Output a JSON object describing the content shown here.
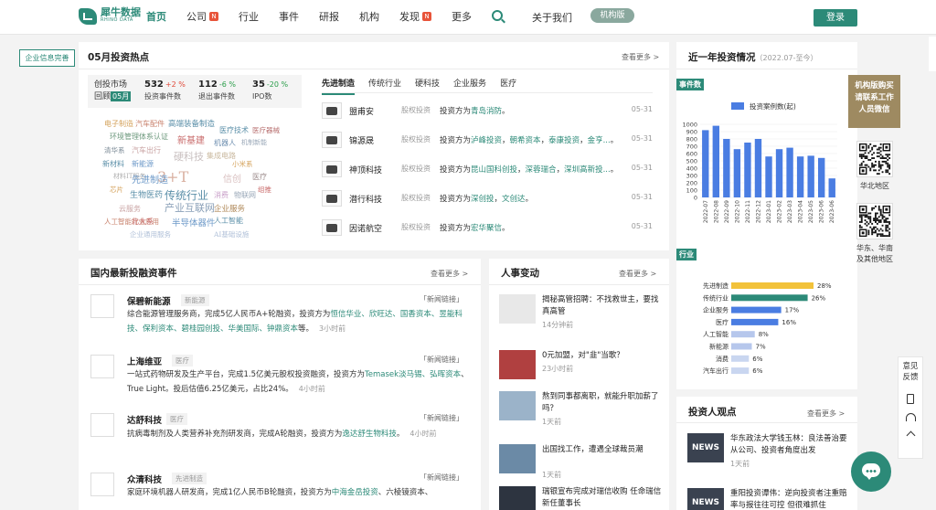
{
  "header": {
    "logo_cn": "犀牛数据",
    "logo_en": "RHINO DATA",
    "nav": [
      {
        "label": "首页",
        "active": true,
        "badge": ""
      },
      {
        "label": "公司",
        "badge": "N"
      },
      {
        "label": "行业",
        "badge": ""
      },
      {
        "label": "事件",
        "badge": ""
      },
      {
        "label": "研报",
        "badge": ""
      },
      {
        "label": "机构",
        "badge": ""
      },
      {
        "label": "发现",
        "badge": "N"
      },
      {
        "label": "更多",
        "badge": ""
      }
    ],
    "about": "关于我们",
    "org_version": "机构版",
    "login": "登录"
  },
  "company_info_button": "企业信息完善",
  "hot": {
    "title": "05月投资热点",
    "more": "查看更多 >",
    "stats_label_1": "创投市场",
    "stats_label_2": "回顾",
    "stats_month": "05月",
    "stats": [
      {
        "num": "532",
        "pct": "+2 %",
        "dir": "up",
        "label": "投资事件数"
      },
      {
        "num": "112",
        "pct": "-6 %",
        "dir": "down",
        "label": "退出事件数"
      },
      {
        "num": "35",
        "pct": "-20 %",
        "dir": "down",
        "label": "IPO数"
      }
    ],
    "cloud": [
      "电子制造",
      "汽车配件",
      "高端装备制造",
      "医疗技术",
      "医疗器械",
      "环境管理体系认证",
      "新基建",
      "机器人",
      "机制新能",
      "清华系",
      "汽车出行",
      "硬科技",
      "集成电路",
      "新材料",
      "新能源",
      "小米系",
      "材料IT服务",
      "3+T",
      "先进制造",
      "信创",
      "医疗",
      "芯片",
      "组推",
      "生物医药",
      "传统行业",
      "消费",
      "物联网",
      "云服务",
      "产业互联网",
      "企业服务",
      "人工智能行业应用",
      "北大系",
      "半导体器件",
      "人工智能",
      "企业通用服务",
      "AI基础设施",
      "集成电路芯片"
    ],
    "tabs": [
      "先进制造",
      "传统行业",
      "硬科技",
      "企业服务",
      "医疗"
    ],
    "deals": [
      {
        "name": "盟甫安",
        "type": "股权投资",
        "prefix": "投资方为",
        "investors": [
          "青岛消防"
        ],
        "date": "05-31"
      },
      {
        "name": "锦源晟",
        "type": "股权投资",
        "prefix": "投资方为",
        "investors": [
          "泸峰投资",
          "朝希资本",
          "泰康投资",
          "金亨..."
        ],
        "date": "05-31"
      },
      {
        "name": "神顶科技",
        "type": "股权投资",
        "prefix": "投资方为",
        "investors": [
          "昆山国科创投",
          "深蓉瑞合",
          "深圳高新投..."
        ],
        "date": "05-31"
      },
      {
        "name": "潜行科技",
        "type": "股权投资",
        "prefix": "投资方为",
        "investors": [
          "深创投",
          "文创达"
        ],
        "date": "05-31"
      },
      {
        "name": "因诺航空",
        "type": "股权投资",
        "prefix": "投资方为",
        "investors": [
          "宏华聚信"
        ],
        "date": "05-31"
      }
    ]
  },
  "news": {
    "title": "国内最新投融资事件",
    "more": "查看更多 >",
    "items": [
      {
        "name": "保碧新能源",
        "tag": "新能源",
        "link": "「新闻链接」",
        "desc_pre": "综合能源管理服务商，完成5亿人民币A+轮融资，投资方为",
        "investors": "恒信华业、欣旺达、国香资本、昱能科技、保利资本、碧桂园创投、华美国际、钟鼎资本",
        "desc_post": "等。",
        "time": "3小时前"
      },
      {
        "name": "上海维亚",
        "tag": "医疗",
        "link": "「新闻链接」",
        "desc_pre": "一站式药物研发及生产平台，完成1.5亿美元股权投资融资，投资方为",
        "investors": "Temasek淡马锡、弘晖资本",
        "desc_post": "、True Light。投后估值6.25亿美元，占比24%。",
        "time": "4小时前"
      },
      {
        "name": "达舒科技",
        "tag": "医疗",
        "link": "「新闻链接」",
        "desc_pre": "抗病毒制剂及人类营养补充剂研发商，完成A轮融资，投资方为",
        "investors": "逸达舒生物科技",
        "desc_post": "。",
        "time": "4小时前"
      },
      {
        "name": "众清科技",
        "tag": "先进制造",
        "link": "「新闻链接」",
        "desc_pre": "家庭环境机器人研发商，完成1亿人民币B轮融资，投资方为",
        "investors": "中海金岳投资",
        "desc_post": "、六棱镜资本、",
        "time": ""
      }
    ]
  },
  "people": {
    "title": "人事变动",
    "more": "查看更多 >",
    "items": [
      {
        "title": "揭秘高管招聘：不找救世主，要找真高管",
        "time": "14分钟前"
      },
      {
        "title": "0元加盟，对\"韭\"当歌？",
        "time": "23小时前"
      },
      {
        "title": "熬到同事都离职，就能升职加薪了吗？",
        "time": "1天前"
      },
      {
        "title": "出国找工作，遭遇全球裁员潮",
        "time": "1天前"
      },
      {
        "title": "瑞银宣布完成对瑞信收购 任命瑞信新任董事长",
        "time": ""
      }
    ]
  },
  "year": {
    "title": "近一年投资情况",
    "subtitle": "（2022.07-至今）",
    "events_badge": "事件数",
    "industry_badge": "行业"
  },
  "chart_data": [
    {
      "type": "bar",
      "title": "",
      "series": [
        {
          "name": "投资案例数(起)",
          "values": [
            920,
            980,
            800,
            660,
            750,
            800,
            560,
            660,
            680,
            560,
            570,
            540,
            260
          ]
        }
      ],
      "categories": [
        "2022-07",
        "2022-08",
        "2022-09",
        "2022-10",
        "2022-11",
        "2022-12",
        "2023-01",
        "2023-02",
        "2023-03",
        "2023-04",
        "2023-05",
        "2023-06",
        "2023-06"
      ],
      "ylim": [
        0,
        1000
      ],
      "yticks": [
        0,
        100,
        200,
        300,
        400,
        500,
        600,
        700,
        800,
        900,
        1000
      ],
      "color": "#4a7de2",
      "legend": "top"
    },
    {
      "type": "bar",
      "orientation": "horizontal",
      "categories": [
        "先进制造",
        "传统行业",
        "企业服务",
        "医疗",
        "人工智能",
        "新能源",
        "消费",
        "汽车出行"
      ],
      "values": [
        28,
        26,
        17,
        16,
        8,
        7,
        6,
        6
      ],
      "labels": [
        "28%",
        "26%",
        "17%",
        "16%",
        "8%",
        "7%",
        "6%",
        "6%"
      ],
      "colors": [
        "#f2c23a",
        "#2c8a78",
        "#4a7de2",
        "#4a7de2",
        "#b6c7ec",
        "#b6c7ec",
        "#c9d6f0",
        "#c9d6f0"
      ]
    }
  ],
  "ad": {
    "line1": "机构版购买",
    "line2": "请联系工作",
    "line3": "人员微信"
  },
  "qr1_label": "华北地区",
  "qr2_label_1": "华东、华南",
  "qr2_label_2": "及其他地区",
  "investor_views": {
    "title": "投资人观点",
    "more": "查看更多 >",
    "items": [
      {
        "title": "华东政法大学钱玉林：良法善治要从公司、投资者角度出发",
        "time": "1天前"
      },
      {
        "title": "重阳投资谭伟：逆向投资者注重赔率与报往往可控 但很难抓住",
        "time": ""
      }
    ]
  },
  "float": {
    "feedback": "意见反馈"
  }
}
